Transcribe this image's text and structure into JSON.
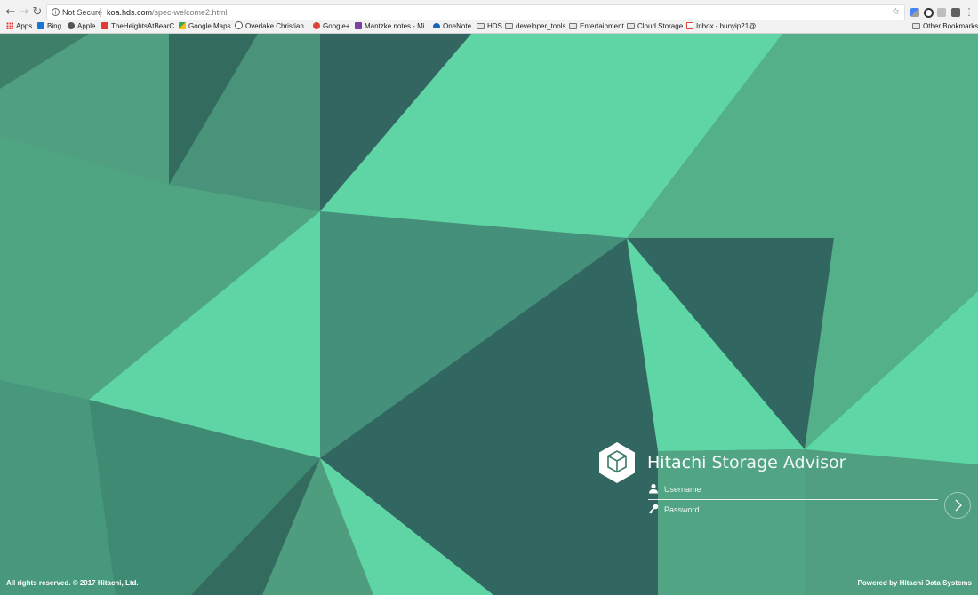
{
  "browser": {
    "nav": {
      "back": "←",
      "forward": "→",
      "reload": "↻"
    },
    "address": {
      "security_label": "Not Secure",
      "url_host": "koa.hds.com",
      "url_path": "/spec-welcome2.html"
    },
    "bookmarks": [
      {
        "label": "Apps",
        "icon": "apps-grid-icon"
      },
      {
        "label": "Bing",
        "icon": "bing-icon"
      },
      {
        "label": "Apple",
        "icon": "apple-icon"
      },
      {
        "label": "TheHeightsAtBearC...",
        "icon": "site-icon"
      },
      {
        "label": "Google Maps",
        "icon": "maps-icon"
      },
      {
        "label": "Overlake Christian...",
        "icon": "site-icon"
      },
      {
        "label": "Google+",
        "icon": "google-plus-icon"
      },
      {
        "label": "Mantzke notes - Mi...",
        "icon": "onenote-icon"
      },
      {
        "label": "OneNote",
        "icon": "cloud-icon"
      },
      {
        "label": "HDS",
        "icon": "folder-icon"
      },
      {
        "label": "developer_tools",
        "icon": "folder-icon"
      },
      {
        "label": "Entertainment",
        "icon": "folder-icon"
      },
      {
        "label": "Cloud Storage",
        "icon": "folder-icon"
      },
      {
        "label": "Inbox - bunyip21@...",
        "icon": "gmail-icon"
      }
    ],
    "other_bookmarks": "Other Bookmarks"
  },
  "login": {
    "brand_primary": "Hitachi",
    "brand_secondary": "Storage Advisor",
    "username_placeholder": "Username",
    "password_placeholder": "Password"
  },
  "footer": {
    "copyright": "All rights reserved. © 2017 Hitachi, Ltd.",
    "powered_by": "Powered by Hitachi Data Systems"
  },
  "colors": {
    "light": "#5fd5a4",
    "mid": "#52b088",
    "dark": "#326660"
  }
}
